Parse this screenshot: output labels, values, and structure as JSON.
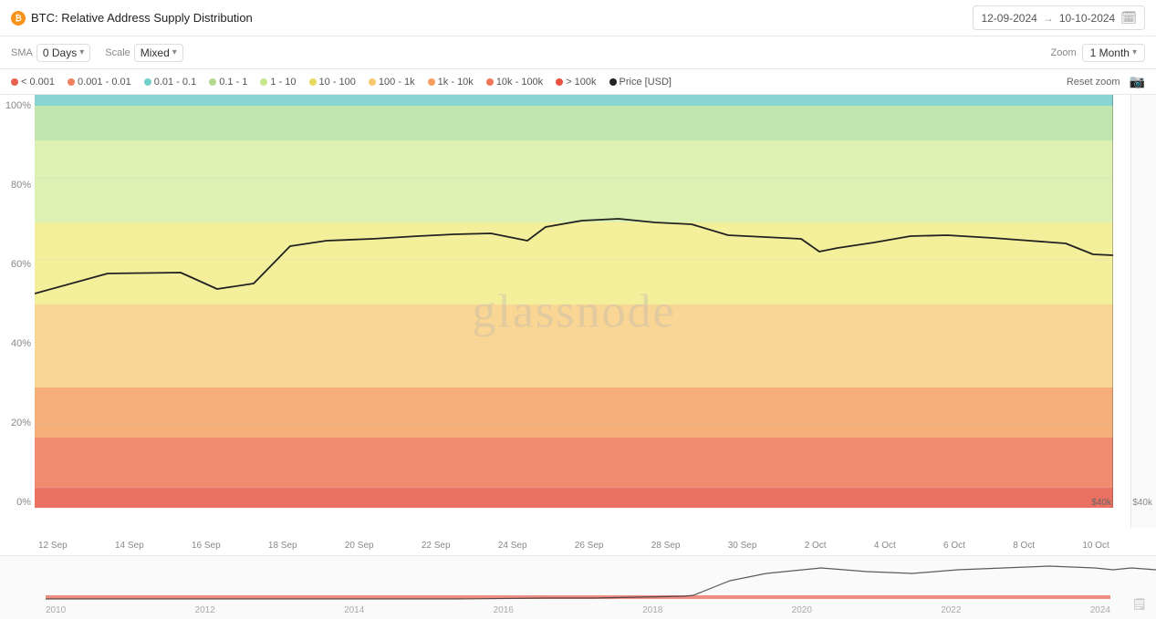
{
  "header": {
    "title": "BTC: Relative Address Supply Distribution",
    "btc_label": "₿",
    "date_start": "12-09-2024",
    "date_end": "10-10-2024",
    "date_separator": "→"
  },
  "controls": {
    "sma_label": "SMA",
    "sma_value": "0 Days",
    "scale_label": "Scale",
    "scale_value": "Mixed",
    "zoom_label": "Zoom",
    "zoom_value": "1 Month"
  },
  "legend": {
    "items": [
      {
        "label": "< 0.001",
        "color": "#e86050"
      },
      {
        "label": "0.001 - 0.01",
        "color": "#f08060"
      },
      {
        "label": "0.01 - 0.1",
        "color": "#72d0c8"
      },
      {
        "label": "0.1 - 1",
        "color": "#b5d890"
      },
      {
        "label": "1 - 10",
        "color": "#c8e890"
      },
      {
        "label": "10 - 100",
        "color": "#e8d860"
      },
      {
        "label": "100 - 1k",
        "color": "#f8c870"
      },
      {
        "label": "1k - 10k",
        "color": "#f5a060"
      },
      {
        "label": "10k - 100k",
        "color": "#f07858"
      },
      {
        "label": "> 100k",
        "color": "#f06050"
      },
      {
        "label": "Price [USD]",
        "color": "#222"
      }
    ],
    "reset_zoom": "Reset zoom"
  },
  "y_axis": {
    "labels": [
      "100%",
      "80%",
      "60%",
      "40%",
      "20%",
      "0%"
    ]
  },
  "x_axis": {
    "labels": [
      "12 Sep",
      "14 Sep",
      "16 Sep",
      "18 Sep",
      "20 Sep",
      "22 Sep",
      "24 Sep",
      "26 Sep",
      "28 Sep",
      "30 Sep",
      "2 Oct",
      "4 Oct",
      "6 Oct",
      "8 Oct",
      "10 Oct"
    ]
  },
  "mini_years": [
    "2010",
    "2012",
    "2014",
    "2016",
    "2018",
    "2020",
    "2022",
    "2024"
  ],
  "right_price": "$40k",
  "watermark": "glassnode"
}
